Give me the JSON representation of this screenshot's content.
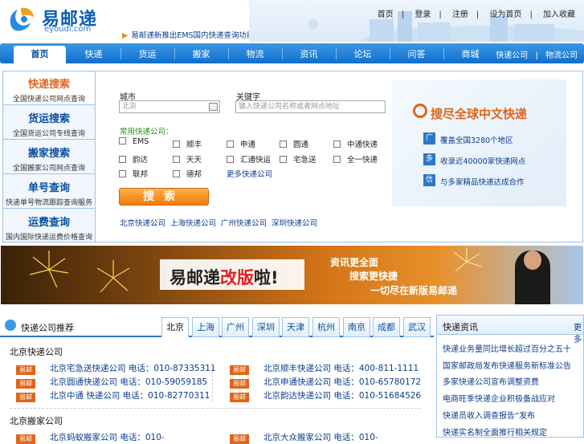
{
  "header": {
    "logo_text": "易邮递",
    "logo_sub": "eyoudi.com",
    "notice": "易邮递新推出EMS国内快递查询功能，欢迎广大用户使用并提出宝贵意见",
    "links": [
      "首页",
      "登录",
      "注册",
      "设为首页",
      "加入收藏"
    ]
  },
  "nav": {
    "tabs": [
      "首页",
      "快递",
      "货运",
      "搬家",
      "物流",
      "资讯",
      "论坛",
      "问答",
      "商城"
    ],
    "right_links": [
      "快递公司",
      "物流公司"
    ]
  },
  "left_tabs": [
    {
      "title": "快递搜索",
      "sub": "全国快递公司网点查询"
    },
    {
      "title": "货运搜索",
      "sub": "全国货运公司专线查询"
    },
    {
      "title": "搬家搜索",
      "sub": "全国搬家公司网点查询"
    },
    {
      "title": "单号查询",
      "sub": "快递单号物流跟踪查询服务"
    },
    {
      "title": "运费查询",
      "sub": "国内国际快递运费价格查询"
    }
  ],
  "search": {
    "city_label": "城市",
    "city_placeholder": "北京",
    "keyword_label": "关键字",
    "keyword_placeholder": "输入快递公司名称或者网点地址",
    "quick_title": "常用快递公司：",
    "companies": [
      "EMS",
      "顺丰",
      "申通",
      "圆通",
      "中通快递",
      "韵达",
      "天天",
      "汇通快运",
      "宅急送",
      "全一快递",
      "联邦",
      "德邦"
    ],
    "more_link": "更多快递公司",
    "button_label": "搜索",
    "quick_links": [
      "北京快递公司",
      "上海快递公司",
      "广州快递公司",
      "深圳快递公司"
    ]
  },
  "promo": {
    "title": "搜尽全球中文快递",
    "items": [
      {
        "badge": "广",
        "text": "覆盖全国3280个地区"
      },
      {
        "badge": "多",
        "text": "收录近40000家快递网点"
      },
      {
        "badge": "信",
        "text": "与多家精品快递达成合作"
      }
    ]
  },
  "banner": {
    "title_pre": "易邮递",
    "title_red": "改版",
    "title_post": "啦!",
    "lines": [
      "资讯更全面",
      "搜索更快捷",
      "一切尽在新版易邮递"
    ]
  },
  "news": {
    "title": "快递公司推荐",
    "city_tabs": [
      "北京",
      "上海",
      "广州",
      "深圳",
      "天津",
      "杭州",
      "南京",
      "成都",
      "武汉"
    ],
    "sections": [
      {
        "title": "北京快递公司",
        "left": [
          {
            "logo": "易邮",
            "text": "北京宅急送快递公司 电话：010-87335311"
          },
          {
            "logo": "易邮",
            "text": "北京圆通快递公司 电话：010-59059185"
          },
          {
            "logo": "易邮",
            "text": "北京中通 快递公司 电话：010-82770311"
          }
        ],
        "right": [
          {
            "logo": "易邮",
            "text": "北京顺丰快递公司 电话：400-811-1111"
          },
          {
            "logo": "易邮",
            "text": "北京申通快递公司 电话：010-65780172"
          },
          {
            "logo": "易邮",
            "text": "北京韵达快递公司 电话：010-51684526"
          }
        ]
      },
      {
        "title": "北京搬家公司",
        "left": [
          {
            "logo": "易邮",
            "text": "北京蚂蚁搬家公司 电话：010-"
          }
        ],
        "right": [
          {
            "logo": "易邮",
            "text": "北京大众搬家公司 电话：010-"
          }
        ]
      }
    ]
  },
  "side": {
    "title": "快递资讯",
    "more": "更多",
    "items": [
      "快递业务量同比增长超过百分之五十",
      "国家邮政局发布快递服务新标准公告",
      "多家快递公司宣布调整资费",
      "电商旺季快递企业积极备战应对",
      "快递员收入调查报告”发布",
      "快递实名制全面推行相关规定"
    ]
  },
  "colors": {
    "brand": "#0a5fb5",
    "nav": "#1477d4",
    "accent": "#e2641a"
  }
}
